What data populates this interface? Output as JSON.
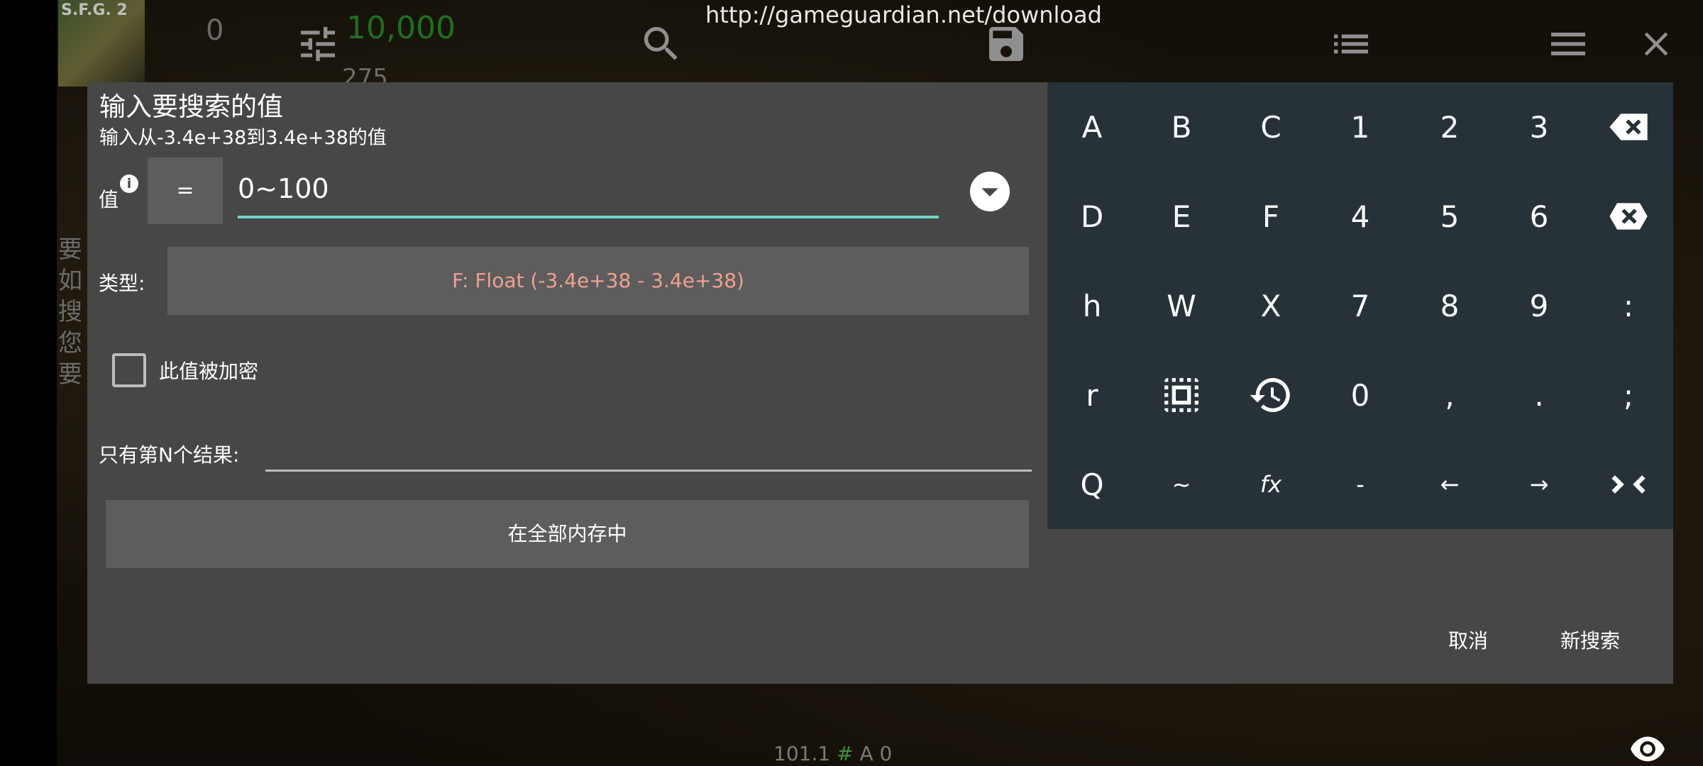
{
  "toolbar": {
    "url": "http://gameguardian.net/download",
    "icons": [
      "tune-icon",
      "search-icon",
      "save-icon",
      "list-icon",
      "menu-icon",
      "close-icon"
    ]
  },
  "background": {
    "logo_text": "S.F.G. 2",
    "score": "10,000",
    "left_number": "0",
    "mid_number": "275",
    "side_text": [
      "要",
      "如",
      "搜",
      "您",
      "要"
    ],
    "status": {
      "version": "101.1",
      "hash": "#",
      "rest": "A 0"
    }
  },
  "dialog": {
    "title": "输入要搜索的值",
    "subtitle": "输入从-3.4e+38到3.4e+38的值",
    "value_label": "值",
    "info_icon": "i",
    "operator": "=",
    "value": "0~100",
    "type_label": "类型:",
    "type_value": "F: Float (-3.4e+38 - 3.4e+38)",
    "encrypted_label": "此值被加密",
    "nth_label": "只有第N个结果:",
    "nth_value": "",
    "region_button": "在全部内存中",
    "cancel": "取消",
    "new_search": "新搜索"
  },
  "keypad": {
    "keys": [
      "A",
      "B",
      "C",
      "1",
      "2",
      "3",
      "backspace-icon",
      "D",
      "E",
      "F",
      "4",
      "5",
      "6",
      "clear-icon",
      "h",
      "W",
      "X",
      "7",
      "8",
      "9",
      ":",
      "r",
      "select-all-icon",
      "history-icon",
      "0",
      ",",
      ".",
      ";",
      "Q",
      "~",
      "fx",
      "-",
      "←",
      "→",
      "collapse-icon"
    ]
  },
  "colors": {
    "dialog_bg": "#474747",
    "field_bg": "#5d5d5d",
    "keypad_bg": "#263238",
    "accent_underline": "#6ed4c7",
    "type_text": "#f0a08f"
  }
}
